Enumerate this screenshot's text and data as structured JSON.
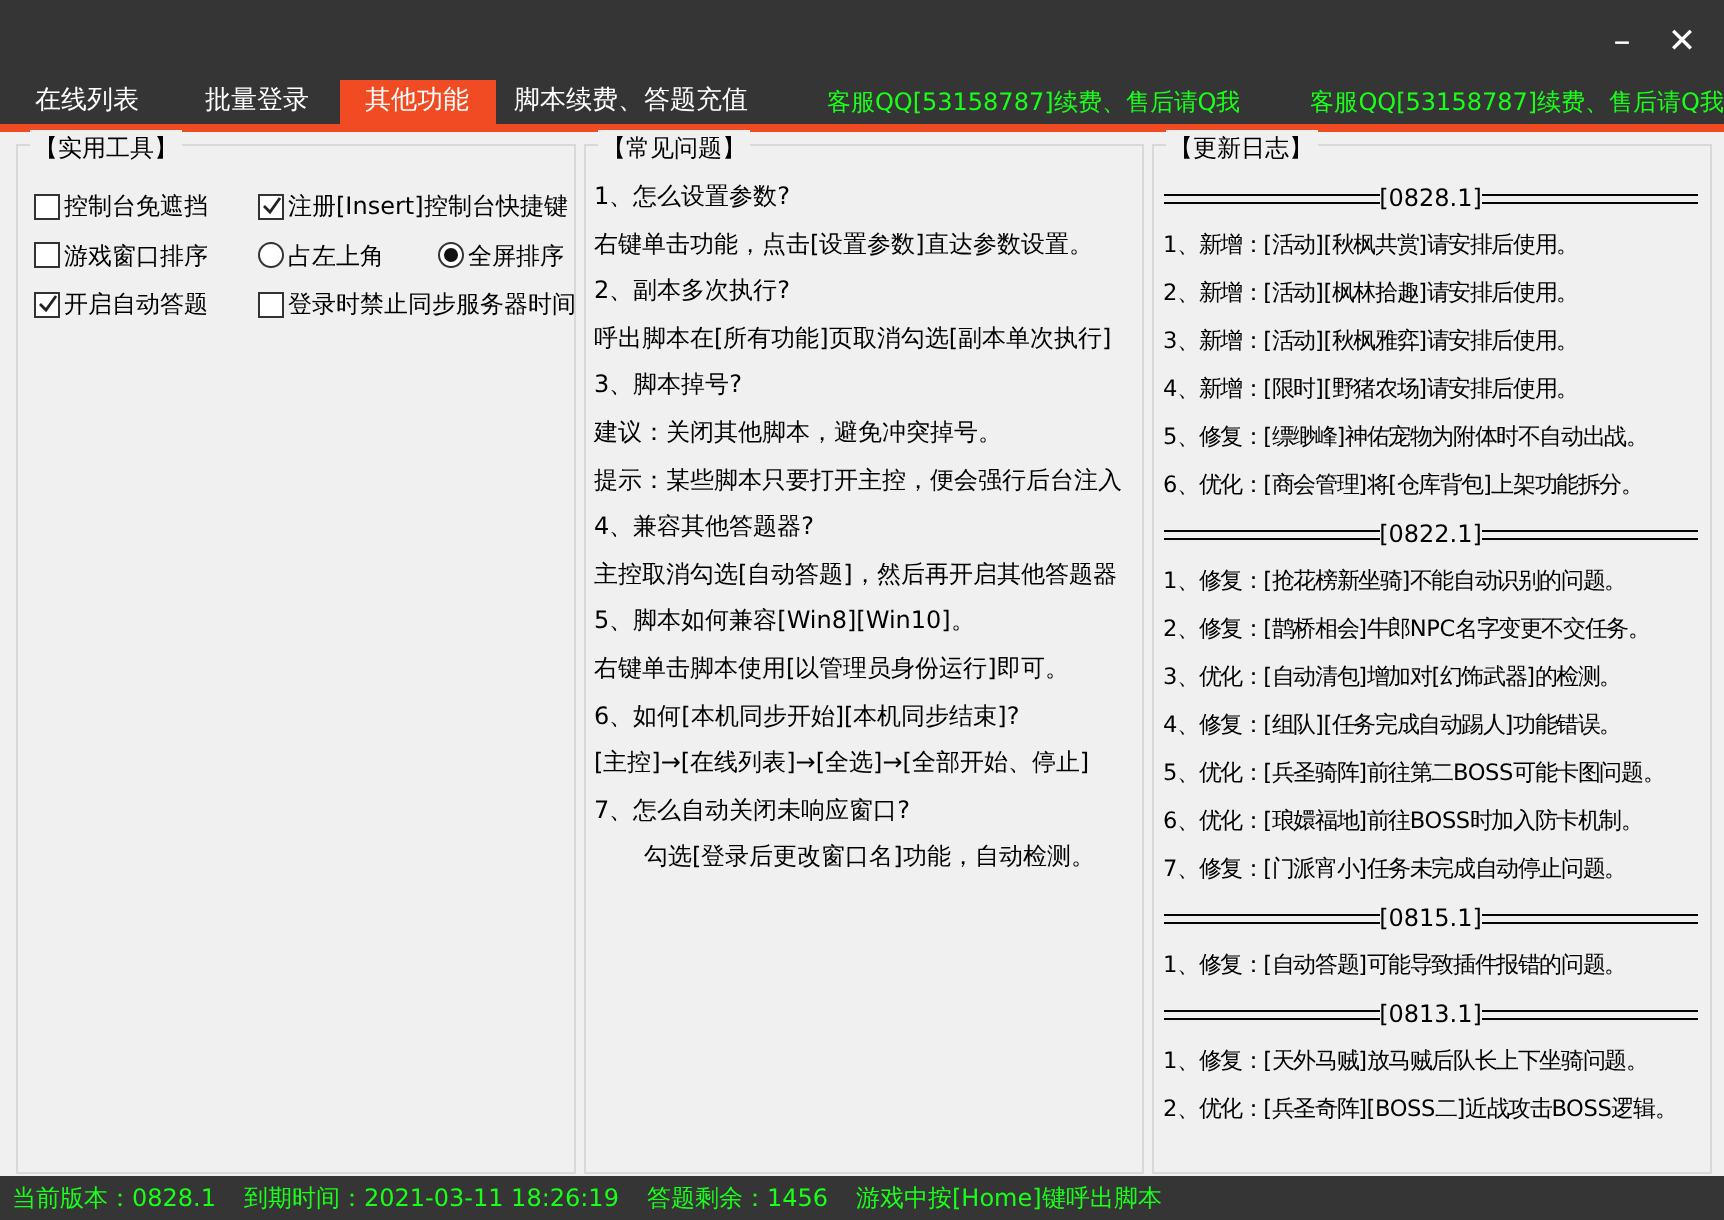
{
  "window": {
    "controls": [
      "–",
      "✕"
    ]
  },
  "tabs": [
    {
      "label": "在线列表",
      "selected": false,
      "kind": "tab"
    },
    {
      "label": "批量登录",
      "selected": false,
      "kind": "tab"
    },
    {
      "label": "其他功能",
      "selected": true,
      "kind": "tab"
    },
    {
      "label": "脚本续费、答题充值",
      "selected": false,
      "kind": "tab"
    },
    {
      "label": "客服QQ[53158787]续费、售后请Q我",
      "kind": "notice"
    },
    {
      "label": "客服QQ[53158787]续费、售后请Q我",
      "kind": "notice"
    }
  ],
  "tools": {
    "title": "【实用工具】",
    "rows": [
      [
        {
          "kind": "checkbox",
          "label": "控制台免遮挡",
          "checked": false
        },
        {
          "kind": "checkbox",
          "label": "注册[Insert]控制台快捷键",
          "checked": true
        }
      ],
      [
        {
          "kind": "checkbox",
          "label": "游戏窗口排序",
          "checked": false
        },
        {
          "kind": "radio",
          "label": "占左上角",
          "selected": false
        },
        {
          "kind": "radio",
          "label": "全屏排序",
          "selected": true
        }
      ],
      [
        {
          "kind": "checkbox",
          "label": "开启自动答题",
          "checked": true
        },
        {
          "kind": "checkbox",
          "label": "登录时禁止同步服务器时间",
          "checked": false
        }
      ]
    ]
  },
  "faq": {
    "title": "【常见问题】",
    "lines": [
      {
        "text": "1、怎么设置参数?",
        "indented": false
      },
      {
        "text": "右键单击功能，点击[设置参数]直达参数设置。",
        "indented": false
      },
      {
        "text": "2、副本多次执行?",
        "indented": false
      },
      {
        "text": "呼出脚本在[所有功能]页取消勾选[副本单次执行]",
        "indented": false
      },
      {
        "text": "3、脚本掉号?",
        "indented": false
      },
      {
        "text": "建议：关闭其他脚本，避免冲突掉号。",
        "indented": false
      },
      {
        "text": "提示：某些脚本只要打开主控，便会强行后台注入",
        "indented": false
      },
      {
        "text": "4、兼容其他答题器?",
        "indented": false
      },
      {
        "text": "主控取消勾选[自动答题]，然后再开启其他答题器",
        "indented": false
      },
      {
        "text": "5、脚本如何兼容[Win8][Win10]。",
        "indented": false
      },
      {
        "text": "右键单击脚本使用[以管理员身份运行]即可。",
        "indented": false
      },
      {
        "text": "6、如何[本机同步开始][本机同步结束]?",
        "indented": false
      },
      {
        "text": "[主控]→[在线列表]→[全选]→[全部开始、停止]",
        "indented": false
      },
      {
        "text": "7、怎么自动关闭未响应窗口?",
        "indented": false
      },
      {
        "text": "勾选[登录后更改窗口名]功能，自动检测。",
        "indented": true
      }
    ]
  },
  "changelog": {
    "title": "【更新日志】",
    "entries": [
      {
        "kind": "version",
        "text": "[0828.1]"
      },
      {
        "kind": "item",
        "text": "1、新增：[活动][秋枫共赏]请安排后使用。"
      },
      {
        "kind": "item",
        "text": "2、新增：[活动][枫林拾趣]请安排后使用。"
      },
      {
        "kind": "item",
        "text": "3、新增：[活动][秋枫雅弈]请安排后使用。"
      },
      {
        "kind": "item",
        "text": "4、新增：[限时][野猪农场]请安排后使用。"
      },
      {
        "kind": "item",
        "text": "5、修复：[缥缈峰]神佑宠物为附体时不自动出战。"
      },
      {
        "kind": "item",
        "text": "6、优化：[商会管理]将[仓库背包]上架功能拆分。"
      },
      {
        "kind": "version",
        "text": "[0822.1]"
      },
      {
        "kind": "item",
        "text": "1、修复：[抢花榜新坐骑]不能自动识别的问题。"
      },
      {
        "kind": "item",
        "text": "2、修复：[鹊桥相会]牛郎NPC名字变更不交任务。"
      },
      {
        "kind": "item",
        "text": "3、优化：[自动清包]增加对[幻饰武器]的检测。"
      },
      {
        "kind": "item",
        "text": "4、修复：[组队][任务完成自动踢人]功能错误。"
      },
      {
        "kind": "item",
        "text": "5、优化：[兵圣骑阵]前往第二BOSS可能卡图问题。"
      },
      {
        "kind": "item",
        "text": "6、优化：[琅嬛福地]前往BOSS时加入防卡机制。"
      },
      {
        "kind": "item",
        "text": "7、修复：[门派宵小]任务未完成自动停止问题。"
      },
      {
        "kind": "version",
        "text": "[0815.1]"
      },
      {
        "kind": "item",
        "text": "1、修复：[自动答题]可能导致插件报错的问题。"
      },
      {
        "kind": "version",
        "text": "[0813.1]"
      },
      {
        "kind": "item",
        "text": "1、修复：[天外马贼]放马贼后队长上下坐骑问题。"
      },
      {
        "kind": "item",
        "text": "2、优化：[兵圣奇阵][BOSS二]近战攻击BOSS逻辑。"
      }
    ]
  },
  "status_bar": [
    "当前版本：0828.1",
    "到期时间：2021-03-11 18:26:19",
    "答题剩余：1456",
    "游戏中按[Home]键呼出脚本"
  ]
}
